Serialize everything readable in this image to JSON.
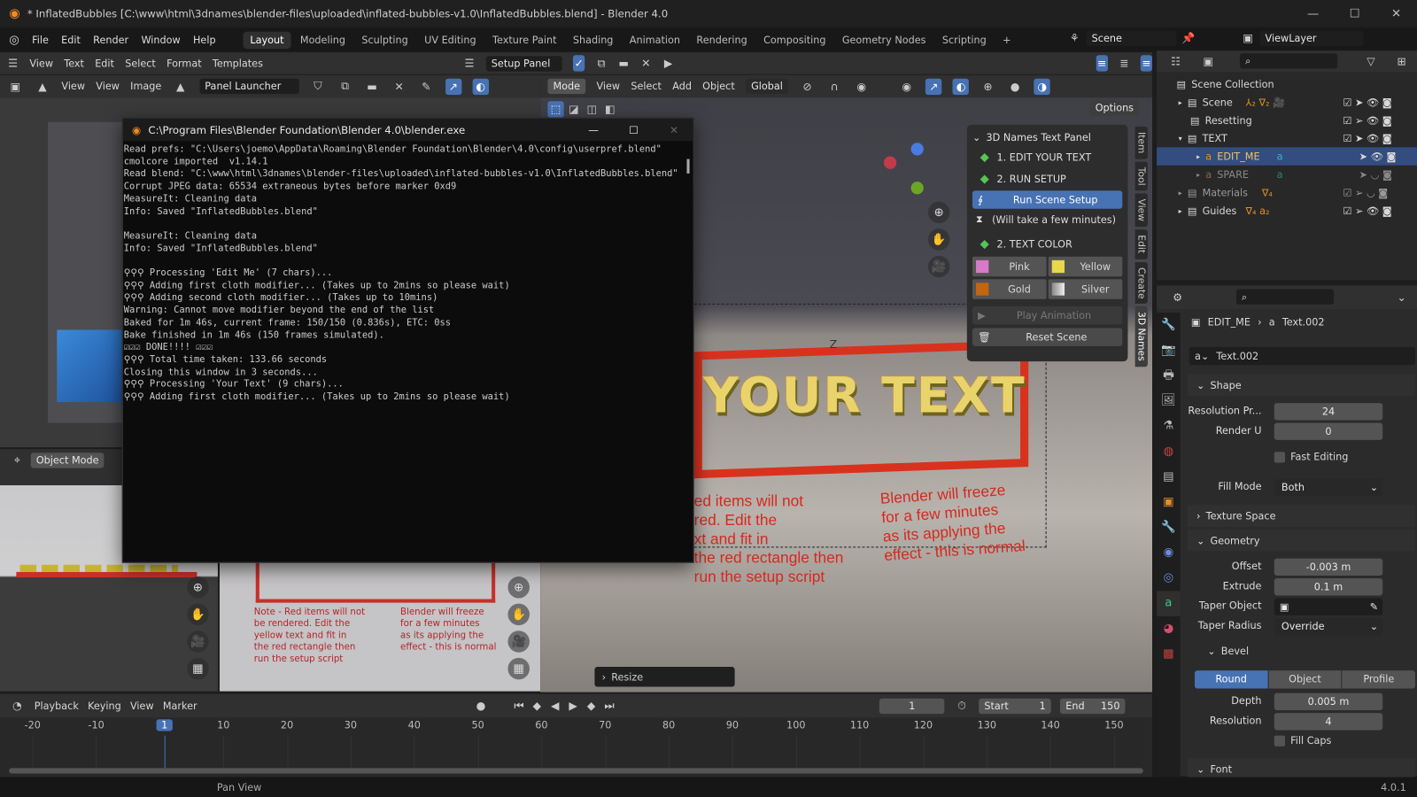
{
  "window": {
    "title": "* InflatedBubbles [C:\\www\\html\\3dnames\\blender-files\\uploaded\\inflated-bubbles-v1.0\\InflatedBubbles.blend] - Blender 4.0",
    "minimize": "—",
    "maximize": "☐",
    "close": "✕"
  },
  "menu": {
    "items": [
      "File",
      "Edit",
      "Render",
      "Window",
      "Help"
    ]
  },
  "workspaces": [
    "Layout",
    "Modeling",
    "Sculpting",
    "UV Editing",
    "Texture Paint",
    "Shading",
    "Animation",
    "Rendering",
    "Compositing",
    "Geometry Nodes",
    "Scripting",
    "+"
  ],
  "scene": {
    "label": "Scene",
    "view_layer": "ViewLayer"
  },
  "text_editor": {
    "menus": [
      "View",
      "Text",
      "Edit",
      "Select",
      "Format",
      "Templates"
    ],
    "file": "Setup Panel"
  },
  "image_editor": {
    "view_dropdown": "View",
    "menus": [
      "View",
      "Image"
    ],
    "image": "Panel Launcher"
  },
  "viewport": {
    "mode": "Mode",
    "menus": [
      "View",
      "Select",
      "Add",
      "Object"
    ],
    "orientation": "Global",
    "options": "Options",
    "axis_z": "Z",
    "resize": "Resize",
    "text_3d": "YOUR TEXT",
    "note_left": [
      "ed items will not",
      "red. Edit the",
      "xt and fit in",
      "the red rectangle then",
      "run the setup script"
    ],
    "note_right": [
      "Blender will freeze",
      "for a few minutes",
      "as its applying the",
      "effect - this is normal"
    ]
  },
  "small_viewport": {
    "mode": "Object Mode",
    "note_left": [
      "Note - Red items will not",
      "be rendered. Edit the",
      "yellow text and fit in",
      "the red rectangle then",
      "run the setup script"
    ],
    "note_right": [
      "Blender will freeze",
      "for a few minutes",
      "as its applying the",
      "effect - this is normal"
    ]
  },
  "console": {
    "title": "C:\\Program Files\\Blender Foundation\\Blender 4.0\\blender.exe",
    "lines": "Read prefs: \"C:\\Users\\joemo\\AppData\\Roaming\\Blender Foundation\\Blender\\4.0\\config\\userpref.blend\"\ncmolcore imported  v1.14.1\nRead blend: \"C:\\www\\html\\3dnames\\blender-files\\uploaded\\inflated-bubbles-v1.0\\InflatedBubbles.blend\"\nCorrupt JPEG data: 65534 extraneous bytes before marker 0xd9\nMeasureIt: Cleaning data\nInfo: Saved \"InflatedBubbles.blend\"\n\nMeasureIt: Cleaning data\nInfo: Saved \"InflatedBubbles.blend\"\n\n⚲⚲⚲ Processing 'Edit Me' (7 chars)...\n⚲⚲⚲ Adding first cloth modifier... (Takes up to 2mins so please wait)\n⚲⚲⚲ Adding second cloth modifier... (Takes up to 10mins)\nWarning: Cannot move modifier beyond the end of the list\nBaked for 1m 46s, current frame: 150/150 (0.836s), ETC: 0ss\nBake finished in 1m 46s (150 frames simulated).\n☑☑☑ DONE!!!! ☑☑☑\n⚲⚲⚲ Total time taken: 133.66 seconds\nClosing this window in 3 seconds...\n⚲⚲⚲ Processing 'Your Text' (9 chars)...\n⚲⚲⚲ Adding first cloth modifier... (Takes up to 2mins so please wait)"
  },
  "names_panel": {
    "title": "3D Names Text Panel",
    "step1": "1. EDIT YOUR TEXT",
    "step2": "2. RUN SETUP",
    "run": "Run Scene Setup",
    "wait": "(Will take a few minutes)",
    "step3": "2. TEXT COLOR",
    "colors": [
      {
        "label": "Pink",
        "color": "#d77bc9"
      },
      {
        "label": "Yellow",
        "color": "#e8d84a"
      },
      {
        "label": "Gold",
        "color": "#c4650f"
      },
      {
        "label": "Silver",
        "color": "#bcbcbc"
      }
    ],
    "play": "Play Animation",
    "reset": "Reset Scene"
  },
  "sidebar_tabs": [
    "Item",
    "Tool",
    "View",
    "Edit",
    "Create",
    "3D Names"
  ],
  "outliner": {
    "root": "Scene Collection",
    "rows": [
      {
        "name": "Scene",
        "badges": "⅄₂ ∇₂ 🎥"
      },
      {
        "name": "Resetting",
        "badges": ""
      },
      {
        "name": "TEXT",
        "badges": ""
      },
      {
        "name": "EDIT_ME",
        "badges": "a",
        "selected": true
      },
      {
        "name": "SPARE",
        "badges": "a"
      },
      {
        "name": "Materials",
        "badges": "∇₄"
      },
      {
        "name": "Guides",
        "badges": "∇₄ a₂"
      }
    ]
  },
  "properties": {
    "object": "EDIT_ME",
    "data": "Text.002",
    "datablock": "Text.002",
    "shape": {
      "title": "Shape",
      "resolution_label": "Resolution Pr...",
      "resolution": "24",
      "render_u_label": "Render U",
      "render_u": "0",
      "fast_editing": "Fast Editing",
      "fill_mode_label": "Fill Mode",
      "fill_mode": "Both"
    },
    "texture_space": "Texture Space",
    "geometry": {
      "title": "Geometry",
      "offset_label": "Offset",
      "offset": "-0.003 m",
      "extrude_label": "Extrude",
      "extrude": "0.1 m",
      "taper_object_label": "Taper Object",
      "taper_radius_label": "Taper Radius",
      "taper_radius": "Override"
    },
    "bevel": {
      "title": "Bevel",
      "modes": [
        "Round",
        "Object",
        "Profile"
      ],
      "active": "Round",
      "depth_label": "Depth",
      "depth": "0.005 m",
      "resolution_label": "Resolution",
      "resolution": "4",
      "fill_caps": "Fill Caps"
    },
    "font": "Font"
  },
  "timeline": {
    "menus": [
      "Playback",
      "Keying",
      "View",
      "Marker"
    ],
    "current_frame": "1",
    "start_label": "Start",
    "start": "1",
    "end_label": "End",
    "end": "150",
    "ticks": [
      "-20",
      "-10",
      "1",
      "10",
      "20",
      "30",
      "40",
      "50",
      "60",
      "70",
      "80",
      "90",
      "100",
      "110",
      "120",
      "130",
      "140",
      "150"
    ]
  },
  "status": {
    "hint": "Pan View",
    "version": "4.0.1"
  }
}
